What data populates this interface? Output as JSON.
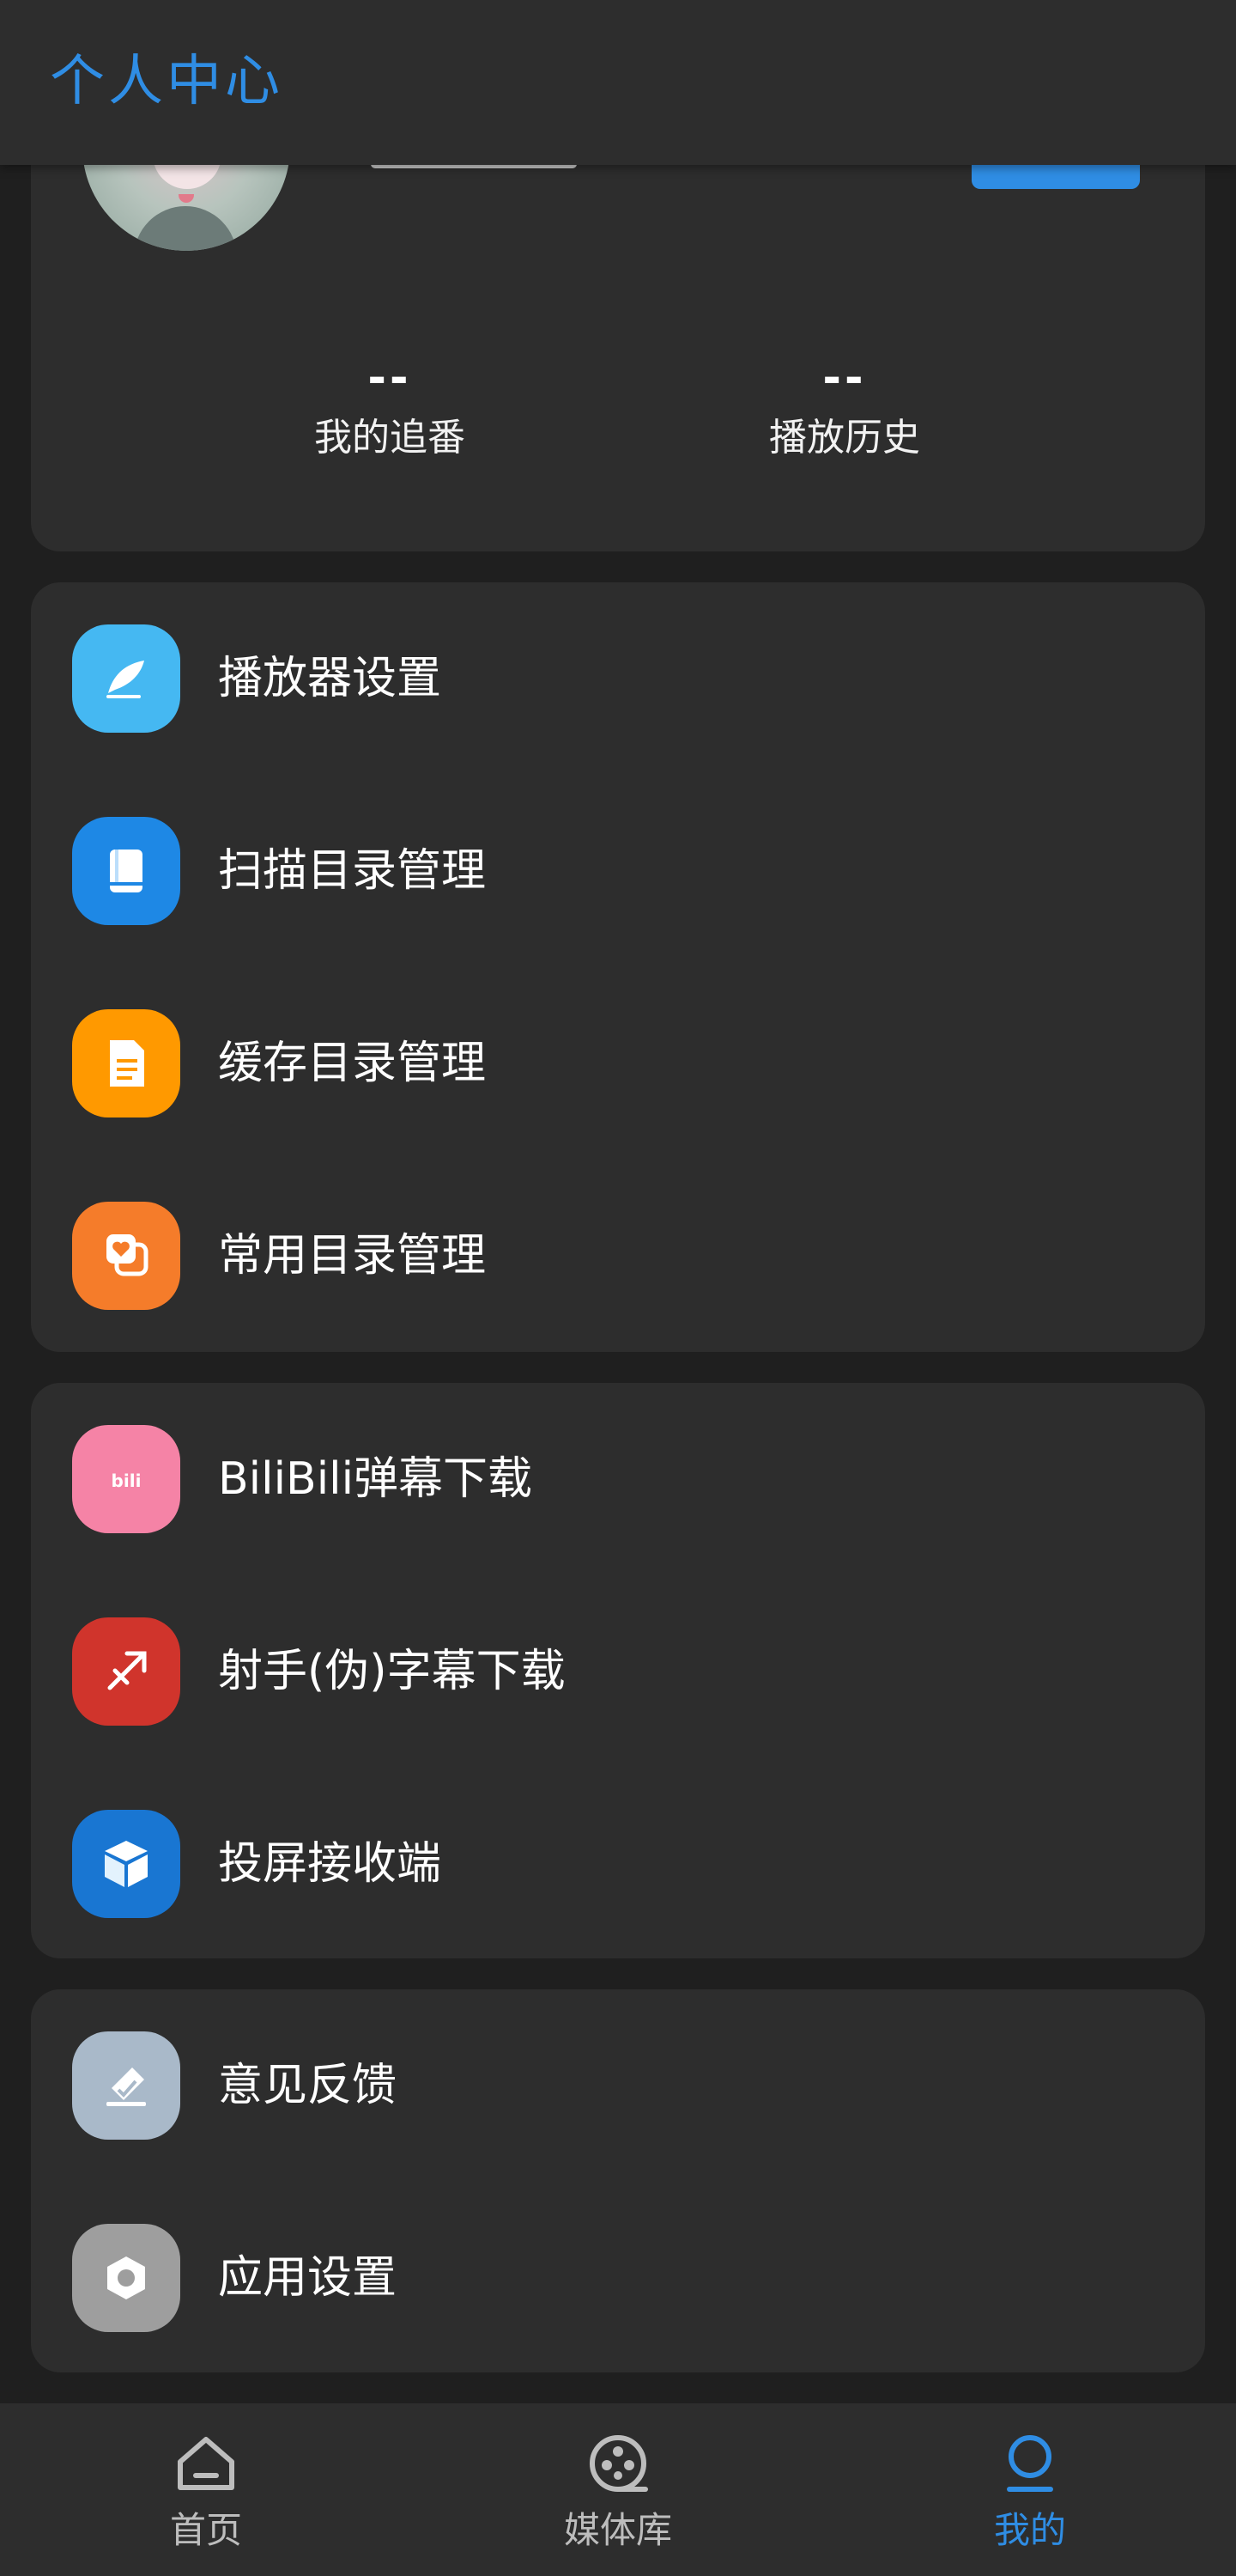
{
  "header": {
    "title": "个人中心"
  },
  "profile": {
    "stats": [
      {
        "value": "--",
        "label": "我的追番"
      },
      {
        "value": "--",
        "label": "播放历史"
      }
    ]
  },
  "groups": [
    {
      "items": [
        {
          "label": "播放器设置",
          "icon": "brush-icon",
          "color": "#45b8f2"
        },
        {
          "label": "扫描目录管理",
          "icon": "book-icon",
          "color": "#1e88e5"
        },
        {
          "label": "缓存目录管理",
          "icon": "document-icon",
          "color": "#ff9900"
        },
        {
          "label": "常用目录管理",
          "icon": "heart-folder-icon",
          "color": "#f57c2a"
        }
      ]
    },
    {
      "items": [
        {
          "label": "BiliBili弹幕下载",
          "icon": "bilibili-icon",
          "color": "#f583a6"
        },
        {
          "label": "射手(伪)字幕下载",
          "icon": "sagittarius-icon",
          "color": "#d0342c"
        },
        {
          "label": "投屏接收端",
          "icon": "cube-icon",
          "color": "#1976d2"
        }
      ]
    },
    {
      "items": [
        {
          "label": "意见反馈",
          "icon": "feedback-icon",
          "color": "#a9b9c9"
        },
        {
          "label": "应用设置",
          "icon": "hexagon-settings-icon",
          "color": "#9e9e9e"
        }
      ]
    }
  ],
  "bottom_nav": {
    "tabs": [
      {
        "label": "首页",
        "icon": "home-icon",
        "active": false
      },
      {
        "label": "媒体库",
        "icon": "film-reel-icon",
        "active": false
      },
      {
        "label": "我的",
        "icon": "user-icon",
        "active": true
      }
    ],
    "active_color": "#2f8de4"
  }
}
